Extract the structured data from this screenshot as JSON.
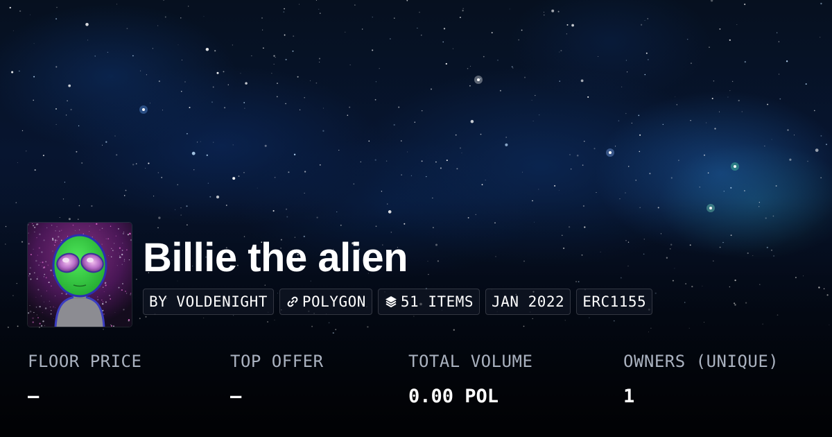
{
  "collection": {
    "name": "Billie the alien",
    "avatar_alt": "alien avatar"
  },
  "tags": {
    "creator": "BY VOLDENIGHT",
    "chain": "POLYGON",
    "items": "51 ITEMS",
    "created": "JAN 2022",
    "standard": "ERC1155"
  },
  "icons": {
    "chain": "link-icon",
    "items": "layers-icon"
  },
  "stats": [
    {
      "label": "FLOOR PRICE",
      "value": "–"
    },
    {
      "label": "TOP OFFER",
      "value": "–"
    },
    {
      "label": "TOTAL VOLUME",
      "value": "0.00 POL"
    },
    {
      "label": "OWNERS (UNIQUE)",
      "value": "1"
    }
  ],
  "colors": {
    "label": "#aab2c0",
    "value": "#ffffff",
    "alien_skin": "#2fd23a",
    "alien_eyes": "#c77fd6"
  }
}
